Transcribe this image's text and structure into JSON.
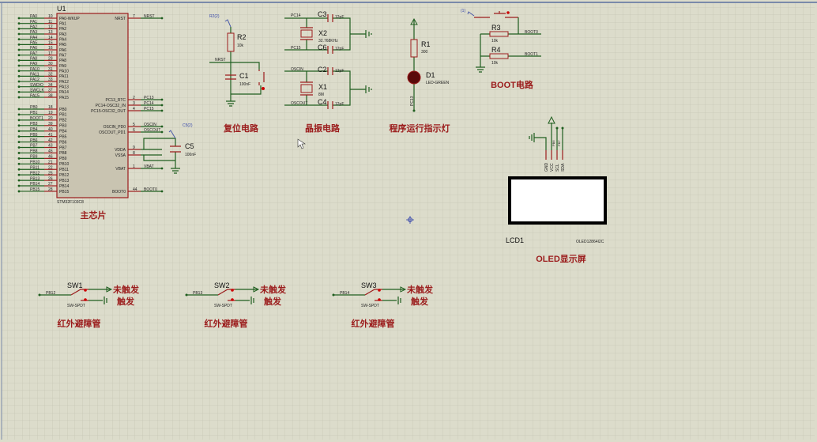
{
  "colors": {
    "wire": "#1f5e1f",
    "pin": "#9b1c1c",
    "body": "#c9c4b1",
    "title": "#9b1c1c",
    "grid": "#c7c7b6",
    "background": "#dcdccb"
  },
  "chip": {
    "ref": "U1",
    "part": "STM32F103C8",
    "title": "主芯片",
    "left_pins": [
      {
        "net": "PA0",
        "num": "10",
        "name": "PA0-WKUP"
      },
      {
        "net": "PA1",
        "num": "11",
        "name": "PA1"
      },
      {
        "net": "PA2",
        "num": "12",
        "name": "PA2"
      },
      {
        "net": "PA3",
        "num": "13",
        "name": "PA3"
      },
      {
        "net": "PA4",
        "num": "14",
        "name": "PA4"
      },
      {
        "net": "PA5",
        "num": "15",
        "name": "PA5"
      },
      {
        "net": "PA6",
        "num": "16",
        "name": "PA6"
      },
      {
        "net": "PA7",
        "num": "17",
        "name": "PA7"
      },
      {
        "net": "PA8",
        "num": "29",
        "name": "PA8"
      },
      {
        "net": "PA9",
        "num": "30",
        "name": "PA9"
      },
      {
        "net": "PA10",
        "num": "31",
        "name": "PA10"
      },
      {
        "net": "PA11",
        "num": "32",
        "name": "PA11"
      },
      {
        "net": "PA12",
        "num": "33",
        "name": "PA12"
      },
      {
        "net": "SWDIO",
        "num": "34",
        "name": "PA13"
      },
      {
        "net": "SWCLK",
        "num": "37",
        "name": "PA14"
      },
      {
        "net": "PA15",
        "num": "38",
        "name": "PA15"
      },
      {
        "net": "PB0",
        "num": "18",
        "name": "PB0"
      },
      {
        "net": "PB1",
        "num": "19",
        "name": "PB1"
      },
      {
        "net": "BOOT1",
        "num": "20",
        "name": "PB2"
      },
      {
        "net": "PB3",
        "num": "39",
        "name": "PB3"
      },
      {
        "net": "PB4",
        "num": "40",
        "name": "PB4"
      },
      {
        "net": "PB5",
        "num": "41",
        "name": "PB5"
      },
      {
        "net": "PB6",
        "num": "42",
        "name": "PB6"
      },
      {
        "net": "PB7",
        "num": "43",
        "name": "PB7"
      },
      {
        "net": "PB8",
        "num": "45",
        "name": "PB8"
      },
      {
        "net": "PB9",
        "num": "46",
        "name": "PB9"
      },
      {
        "net": "PB10",
        "num": "21",
        "name": "PB10"
      },
      {
        "net": "PB11",
        "num": "22",
        "name": "PB11"
      },
      {
        "net": "PB12",
        "num": "25",
        "name": "PB12"
      },
      {
        "net": "PB13",
        "num": "26",
        "name": "PB13"
      },
      {
        "net": "PB14",
        "num": "27",
        "name": "PB14"
      },
      {
        "net": "PB15",
        "num": "28",
        "name": "PB15"
      }
    ],
    "right_pins": [
      {
        "net": "NRST",
        "num": "7",
        "name": "NRST"
      },
      {
        "net": "PC13",
        "num": "2",
        "name": "PC13_RTC"
      },
      {
        "net": "PC14",
        "num": "3",
        "name": "PC14-OSC32_IN"
      },
      {
        "net": "PC15",
        "num": "4",
        "name": "PC15-OSC32_OUT"
      },
      {
        "net": "OSCIN",
        "num": "5",
        "name": "OSCIN_PD0"
      },
      {
        "net": "OSCOUT",
        "num": "6",
        "name": "OSCOUT_PD1"
      },
      {
        "net": "",
        "num": "9",
        "name": "VDDA"
      },
      {
        "net": "",
        "num": "8",
        "name": "VSSA"
      },
      {
        "net": "VBAT",
        "num": "1",
        "name": "VBAT"
      },
      {
        "net": "BOOT0",
        "num": "44",
        "name": "BOOT0"
      }
    ],
    "c5": {
      "ref": "C5",
      "value": "100nF",
      "probe": "C5(2)"
    }
  },
  "reset": {
    "title": "复位电路",
    "probe": "R2(2)",
    "r_ref": "R2",
    "r_val": "10k",
    "net": "NRST",
    "c_ref": "C1",
    "c_val": "100nF"
  },
  "crystal": {
    "title": "晶振电路",
    "nets": [
      "PC14",
      "PC15",
      "OSCIN",
      "OSCOUT"
    ],
    "caps": [
      {
        "ref": "C3",
        "val": "12pF"
      },
      {
        "ref": "C6",
        "val": "12pF"
      },
      {
        "ref": "C2",
        "val": "12pF"
      },
      {
        "ref": "C4",
        "val": "12pF"
      }
    ],
    "x2": {
      "ref": "X2",
      "val": "32.768KHz"
    },
    "x1": {
      "ref": "X1",
      "val": "8M"
    }
  },
  "led": {
    "title": "程序运行指示灯",
    "r_ref": "R1",
    "r_val": "300",
    "d_ref": "D1",
    "d_val": "LED-GREEN",
    "net": "PC13"
  },
  "boot": {
    "title": "BOOT电路",
    "probe": "(1)",
    "r3": "R3",
    "r3_val": "10k",
    "r4": "R4",
    "r4_val": "10k",
    "net0": "BOOT0",
    "net1": "BOOT1"
  },
  "oled": {
    "title": "OLED显示屏",
    "ref": "LCD1",
    "part": "OLED12864I2C",
    "pins": [
      "GND",
      "VCC",
      "SCL",
      "SDA"
    ],
    "nets": [
      "PB6",
      "PB7"
    ]
  },
  "switches": [
    {
      "ref": "SW1",
      "part": "SW-SPDT",
      "net": "PB12",
      "off": "未触发",
      "on": "触发",
      "title": "红外避障管"
    },
    {
      "ref": "SW2",
      "part": "SW-SPDT",
      "net": "PB13",
      "off": "未触发",
      "on": "触发",
      "title": "红外避障管"
    },
    {
      "ref": "SW3",
      "part": "SW-SPDT",
      "net": "PB14",
      "off": "未触发",
      "on": "触发",
      "title": "红外避障管"
    }
  ]
}
